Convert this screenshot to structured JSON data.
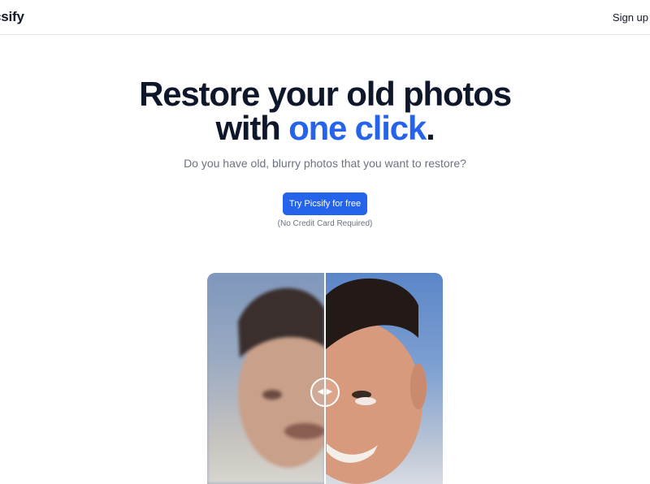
{
  "header": {
    "logo": "csify",
    "signup_label": "Sign up"
  },
  "hero": {
    "title_line1": "Restore your old photos",
    "title_line2_prefix": "with ",
    "title_line2_accent": "one click",
    "title_line2_suffix": ".",
    "subtitle": "Do you have old, blurry photos that you want to restore?",
    "cta_label": "Try Picsify for free",
    "note": "(No Credit Card Required)"
  },
  "compare": {
    "left_icon": "chevron-left-icon",
    "right_icon": "chevron-right-icon"
  },
  "colors": {
    "accent": "#2563eb",
    "title": "#0f172a",
    "muted": "#6b7280"
  }
}
